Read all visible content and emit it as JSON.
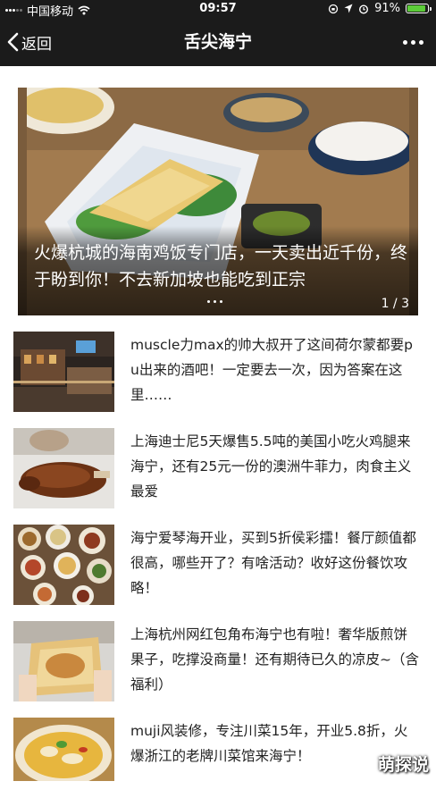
{
  "status_bar": {
    "carrier": "中国移动",
    "time": "09:57",
    "battery": "91%",
    "battery_level": 0.91
  },
  "nav": {
    "back_label": "返回",
    "title": "舌尖海宁"
  },
  "carousel": {
    "caption": "火爆杭城的海南鸡饭专门店，一天卖出近千份，终于盼到你！不去新加坡也能吃到正宗",
    "counter": "1 / 3"
  },
  "articles": [
    {
      "title": "muscle力max的帅大叔开了这间荷尔蒙都要pu出来的酒吧！一定要去一次，因为答案在这里……"
    },
    {
      "title": "上海迪士尼5天爆售5.5吨的美国小吃火鸡腿来海宁，还有25元一份的澳洲牛菲力，肉食主义最爱"
    },
    {
      "title": "海宁爱琴海开业，买到5折侯彩擂！餐厅颜值都很高，哪些开了？有啥活动？收好这份餐饮攻略！"
    },
    {
      "title": "上海杭州网红包角布海宁也有啦！奢华版煎饼果子，吃撑没商量！还有期待已久的凉皮~（含福利）"
    },
    {
      "title": "muji风装修，专注川菜15年，开业5.8折，火爆浙江的老牌川菜馆来海宁！"
    }
  ],
  "watermark": "萌探说"
}
